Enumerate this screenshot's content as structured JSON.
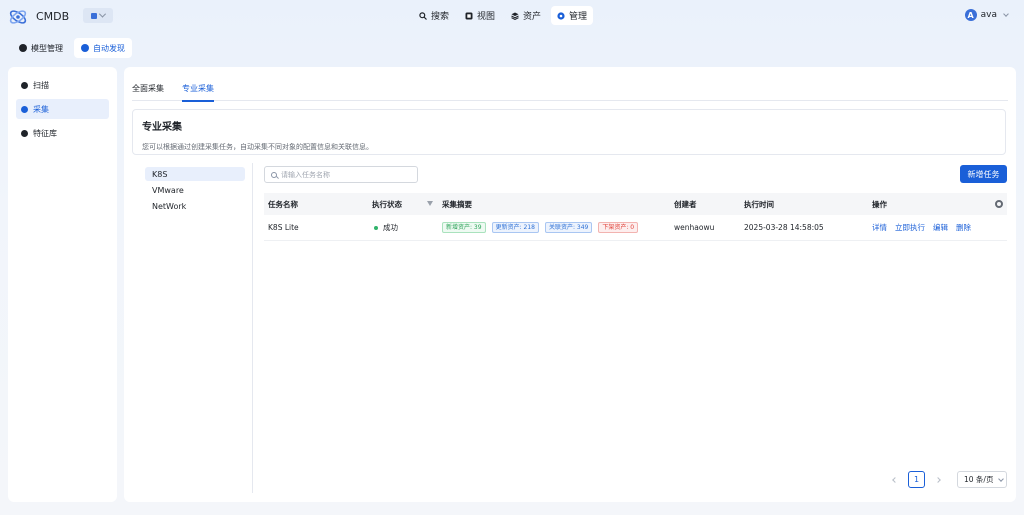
{
  "app": {
    "name": "CMDB"
  },
  "nav": {
    "items": [
      {
        "label": "搜索",
        "icon": "search-icon"
      },
      {
        "label": "视图",
        "icon": "view-icon"
      },
      {
        "label": "资产",
        "icon": "layers-icon"
      },
      {
        "label": "管理",
        "icon": "manage-icon",
        "active": true
      }
    ]
  },
  "user": {
    "initial": "A",
    "name": "ava"
  },
  "subtabs": [
    {
      "label": "模型管理",
      "icon": "model-icon"
    },
    {
      "label": "自动发现",
      "icon": "discover-icon",
      "active": true
    }
  ],
  "sidebar": {
    "items": [
      {
        "label": "扫描",
        "icon": "scan-icon"
      },
      {
        "label": "采集",
        "icon": "collect-icon",
        "active": true
      },
      {
        "label": "特征库",
        "icon": "feature-icon"
      }
    ]
  },
  "tabs": [
    {
      "label": "全面采集"
    },
    {
      "label": "专业采集",
      "active": true
    }
  ],
  "intro": {
    "title": "专业采集",
    "desc": "您可以根据通过创建采集任务，自动采集不同对象的配置信息和关联信息。"
  },
  "tree": {
    "items": [
      "K8S",
      "VMware",
      "NetWork"
    ],
    "active": "K8S"
  },
  "search": {
    "placeholder": "请输入任务名称",
    "value": ""
  },
  "toolbar": {
    "new_task_label": "新增任务"
  },
  "table": {
    "headers": {
      "name": "任务名称",
      "status": "执行状态",
      "summary": "采集摘要",
      "creator": "创建者",
      "time": "执行时间",
      "actions": "操作"
    },
    "rows": [
      {
        "name": "K8S Lite",
        "status": "成功",
        "tags": {
          "added": "新增资产: 39",
          "updated": "更新资产: 218",
          "related": "关联资产: 349",
          "removed": "下架资产: 0"
        },
        "creator": "wenhaowu",
        "time": "2025-03-28 14:58:05",
        "actions": {
          "detail": "详情",
          "run": "立即执行",
          "edit": "编辑",
          "delete": "删除"
        }
      }
    ]
  },
  "pagination": {
    "current": "1",
    "page_size": "10 条/页"
  },
  "colors": {
    "accent": "#1a5fd8",
    "success": "#30b36b"
  }
}
